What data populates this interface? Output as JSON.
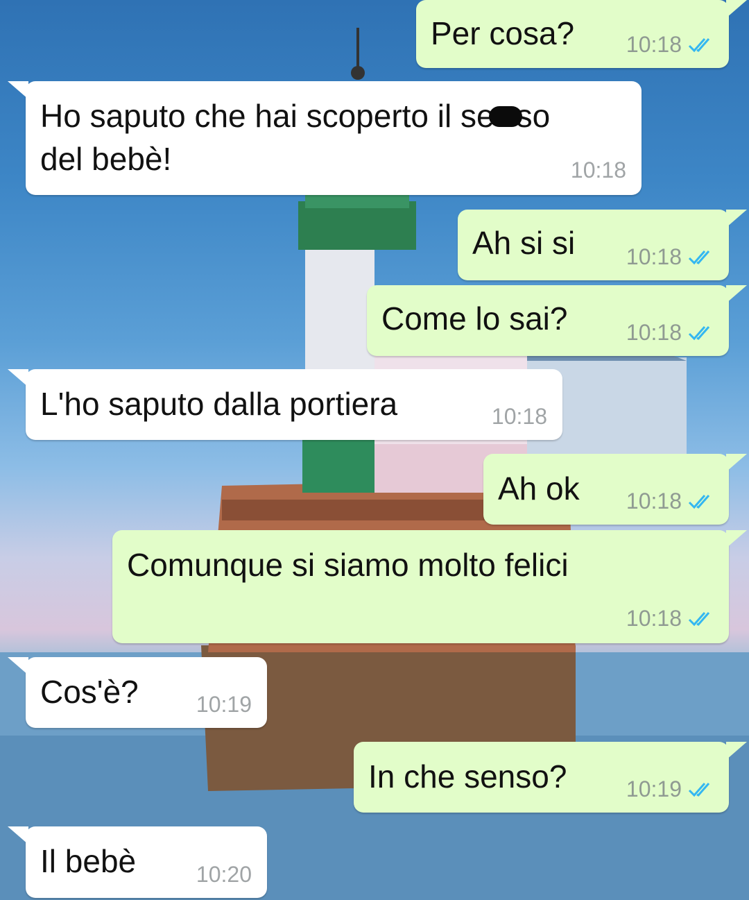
{
  "chat": {
    "messages": [
      {
        "direction": "out",
        "text": "Per cosa?",
        "time": "10:18",
        "status": "read"
      },
      {
        "direction": "in",
        "text_before": "Ho saputo che hai scoperto il se",
        "text_after": "so",
        "text_line2": "del bebè!",
        "time": "10:18"
      },
      {
        "direction": "out",
        "text": "Ah si si",
        "time": "10:18",
        "status": "read"
      },
      {
        "direction": "out",
        "text": "Come lo sai?",
        "time": "10:18",
        "status": "read"
      },
      {
        "direction": "in",
        "text": "L'ho saputo dalla portiera",
        "time": "10:18"
      },
      {
        "direction": "out",
        "text": "Ah ok",
        "time": "10:18",
        "status": "read"
      },
      {
        "direction": "out",
        "text": "Comunque si siamo molto felici",
        "time": "10:18",
        "status": "read"
      },
      {
        "direction": "in",
        "text": "Cos'è?",
        "time": "10:19"
      },
      {
        "direction": "out",
        "text": "In che senso?",
        "time": "10:19",
        "status": "read"
      },
      {
        "direction": "in",
        "text": "Il bebè",
        "time": "10:20"
      }
    ]
  },
  "colors": {
    "outgoing_bubble": "#e2fdc9",
    "incoming_bubble": "#ffffff",
    "read_check": "#34b7f1"
  },
  "icons": {
    "read_receipt": "double-check-icon",
    "redaction": "redaction-mark"
  }
}
